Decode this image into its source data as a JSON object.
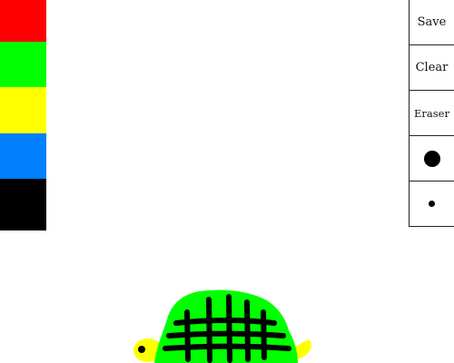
{
  "palette": {
    "colors": [
      {
        "name": "red",
        "value": "#ff0000"
      },
      {
        "name": "green",
        "value": "#00ff00"
      },
      {
        "name": "yellow",
        "value": "#ffff00"
      },
      {
        "name": "blue",
        "value": "#0080ff"
      },
      {
        "name": "black",
        "value": "#000000"
      }
    ]
  },
  "toolbar": {
    "save_label": "Save",
    "clear_label": "Clear",
    "eraser_label": "Eraser",
    "large_brush_icon": "large-dot-icon",
    "small_brush_icon": "small-dot-icon"
  },
  "drawing": {
    "subject": "turtle",
    "colors": {
      "shell": "#00ff00",
      "grid": "#000000",
      "head_and_tail": "#ffff00",
      "eye": "#000000"
    }
  }
}
